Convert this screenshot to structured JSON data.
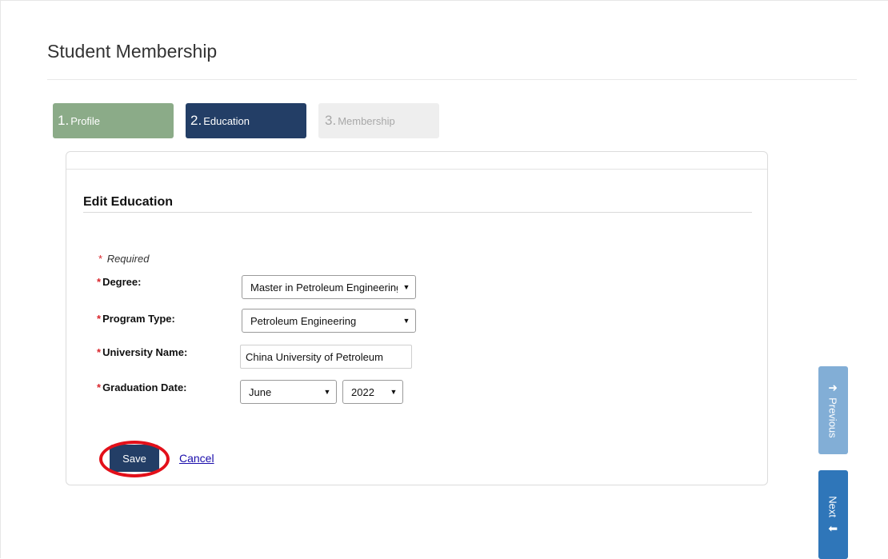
{
  "page": {
    "title": "Student Membership"
  },
  "steps": [
    {
      "number": "1.",
      "label": "Profile",
      "state": "completed"
    },
    {
      "number": "2.",
      "label": "Education",
      "state": "active"
    },
    {
      "number": "3.",
      "label": "Membership",
      "state": "upcoming"
    }
  ],
  "form": {
    "section_title": "Edit Education",
    "required_marker": "*",
    "required_note": "Required",
    "degree": {
      "label": "Degree:",
      "value": "Master in Petroleum Engineering"
    },
    "program_type": {
      "label": "Program Type:",
      "value": "Petroleum Engineering"
    },
    "university_name": {
      "label": "University Name:",
      "value": "China University of Petroleum"
    },
    "graduation_date": {
      "label": "Graduation Date:",
      "month": "June",
      "year": "2022"
    }
  },
  "actions": {
    "save_label": "Save",
    "cancel_label": "Cancel"
  },
  "side_nav": {
    "previous_label": "Previous",
    "next_label": "Next"
  },
  "colors": {
    "step_completed": "#8bab88",
    "step_active": "#233e66",
    "step_upcoming": "#eeeeee",
    "required_star": "#d9262c",
    "highlight_ring": "#e3101a",
    "previous_button": "#82aed6",
    "next_button": "#2f76b9"
  },
  "icons": {
    "previous": "arrow-up-icon",
    "next": "arrow-down-icon",
    "dropdown": "caret-down-icon"
  }
}
